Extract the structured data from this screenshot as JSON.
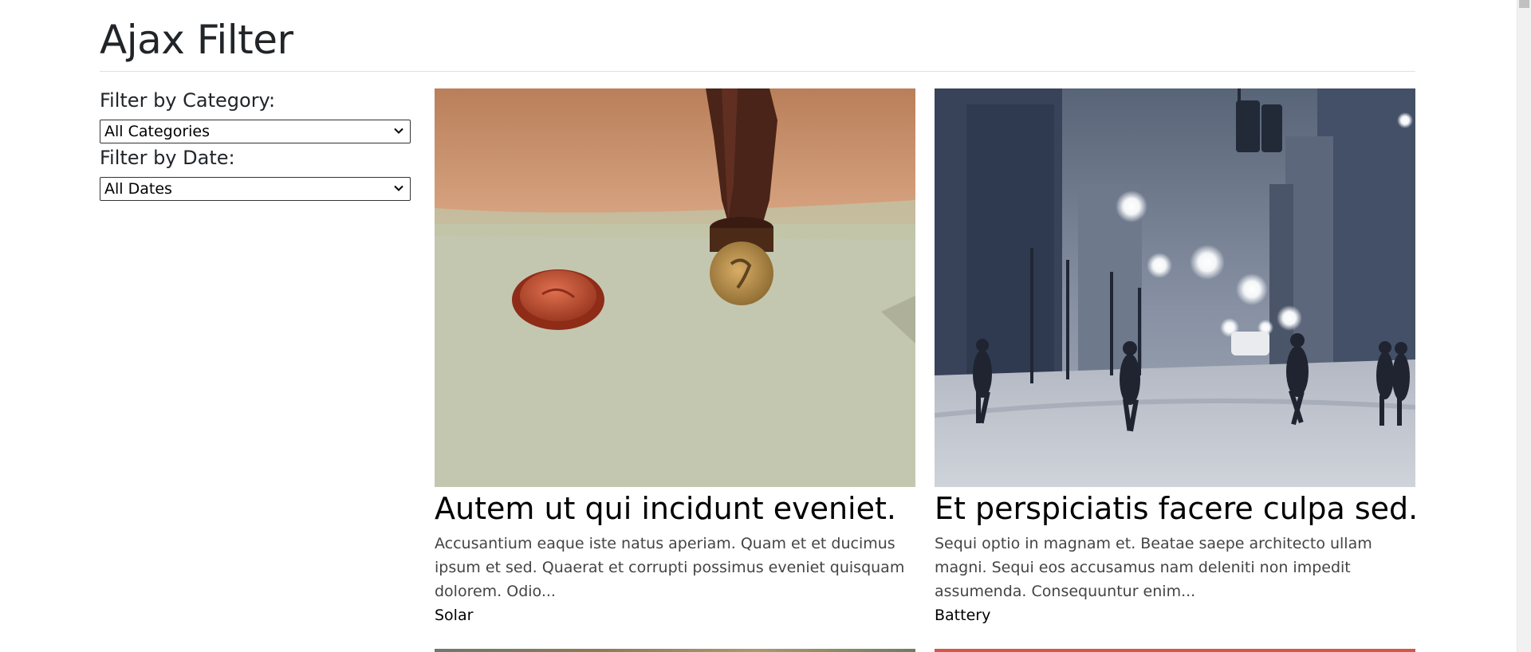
{
  "page": {
    "title": "Ajax Filter"
  },
  "filters": {
    "category_label": "Filter by Category:",
    "category_selected": "All Categories",
    "date_label": "Filter by Date:",
    "date_selected": "All Dates"
  },
  "posts": [
    {
      "title": "Autem ut qui incidunt eveniet.",
      "excerpt": "Accusantium eaque iste natus aperiam. Quam et et ducimus ipsum et sed. Quaerat et corrupti possimus eveniet quisquam dolorem. Odio...",
      "category": "Solar",
      "image": "wax-seal-stamp-photo"
    },
    {
      "title": "Et perspiciatis facere culpa sed.",
      "excerpt": "Sequi optio in magnam et. Beatae saepe architecto ullam magni. Sequi eos accusamus nam deleniti non impedit assumenda. Consequuntur enim...",
      "category": "Battery",
      "image": "snowy-city-street-photo"
    }
  ],
  "colors": {
    "text": "#212529",
    "rule": "#dee2e6",
    "second_row_card_2_top": "#d4574a"
  }
}
